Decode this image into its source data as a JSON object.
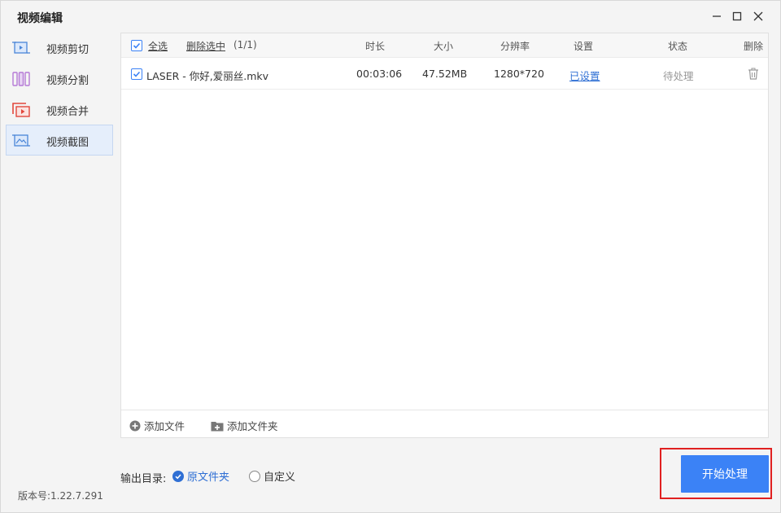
{
  "window": {
    "title": "视频编辑"
  },
  "sidebar": {
    "items": [
      {
        "label": "视频剪切",
        "icon": "video-cut-icon"
      },
      {
        "label": "视频分割",
        "icon": "video-split-icon"
      },
      {
        "label": "视频合并",
        "icon": "video-merge-icon"
      },
      {
        "label": "视频截图",
        "icon": "video-screenshot-icon",
        "active": true
      }
    ]
  },
  "version": "版本号:1.22.7.291",
  "table": {
    "select_all": "全选",
    "delete_selected": "删除选中",
    "count": "(1/1)",
    "headers": {
      "duration": "时长",
      "size": "大小",
      "resolution": "分辨率",
      "settings": "设置",
      "status": "状态",
      "delete": "删除"
    },
    "rows": [
      {
        "checked": true,
        "name": "LASER - 你好,爱丽丝.mkv",
        "duration": "00:03:06",
        "size": "47.52MB",
        "resolution": "1280*720",
        "settings": "已设置",
        "status": "待处理"
      }
    ]
  },
  "footer": {
    "add_file": "添加文件",
    "add_folder": "添加文件夹"
  },
  "output": {
    "label": "输出目录:",
    "option_original": "原文件夹",
    "option_custom": "自定义",
    "selected": "原文件夹"
  },
  "start_button": "开始处理",
  "colors": {
    "accent": "#3b82f6",
    "highlight_border": "#e02020"
  }
}
